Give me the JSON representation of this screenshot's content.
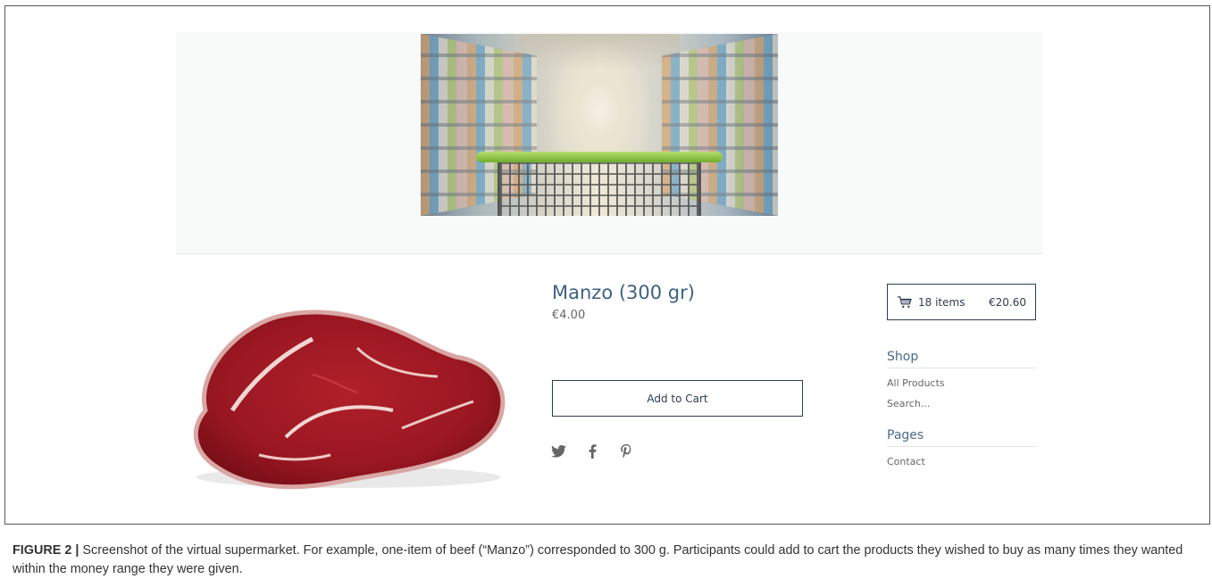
{
  "product": {
    "title": "Manzo (300 gr)",
    "price": "€4.00",
    "add_to_cart_label": "Add to Cart"
  },
  "social": {
    "icons": [
      "twitter-icon",
      "facebook-icon",
      "pinterest-icon"
    ]
  },
  "cart": {
    "count_label": "18 items",
    "total": "€20.60"
  },
  "sidebar": {
    "shop_heading": "Shop",
    "shop_links": [
      "All Products",
      "Search..."
    ],
    "pages_heading": "Pages",
    "pages_links": [
      "Contact"
    ]
  },
  "caption": {
    "label": "FIGURE 2 |",
    "text": " Screenshot of the virtual supermarket. For example, one-item of beef (“Manzo”) corresponded to 300 g. Participants could add to cart the products they wished to buy as many times they wanted within the money range they were given."
  },
  "colors": {
    "title_blue": "#3e6282",
    "button_border": "#2b3d52",
    "heading_blue": "#4a6a8c"
  }
}
